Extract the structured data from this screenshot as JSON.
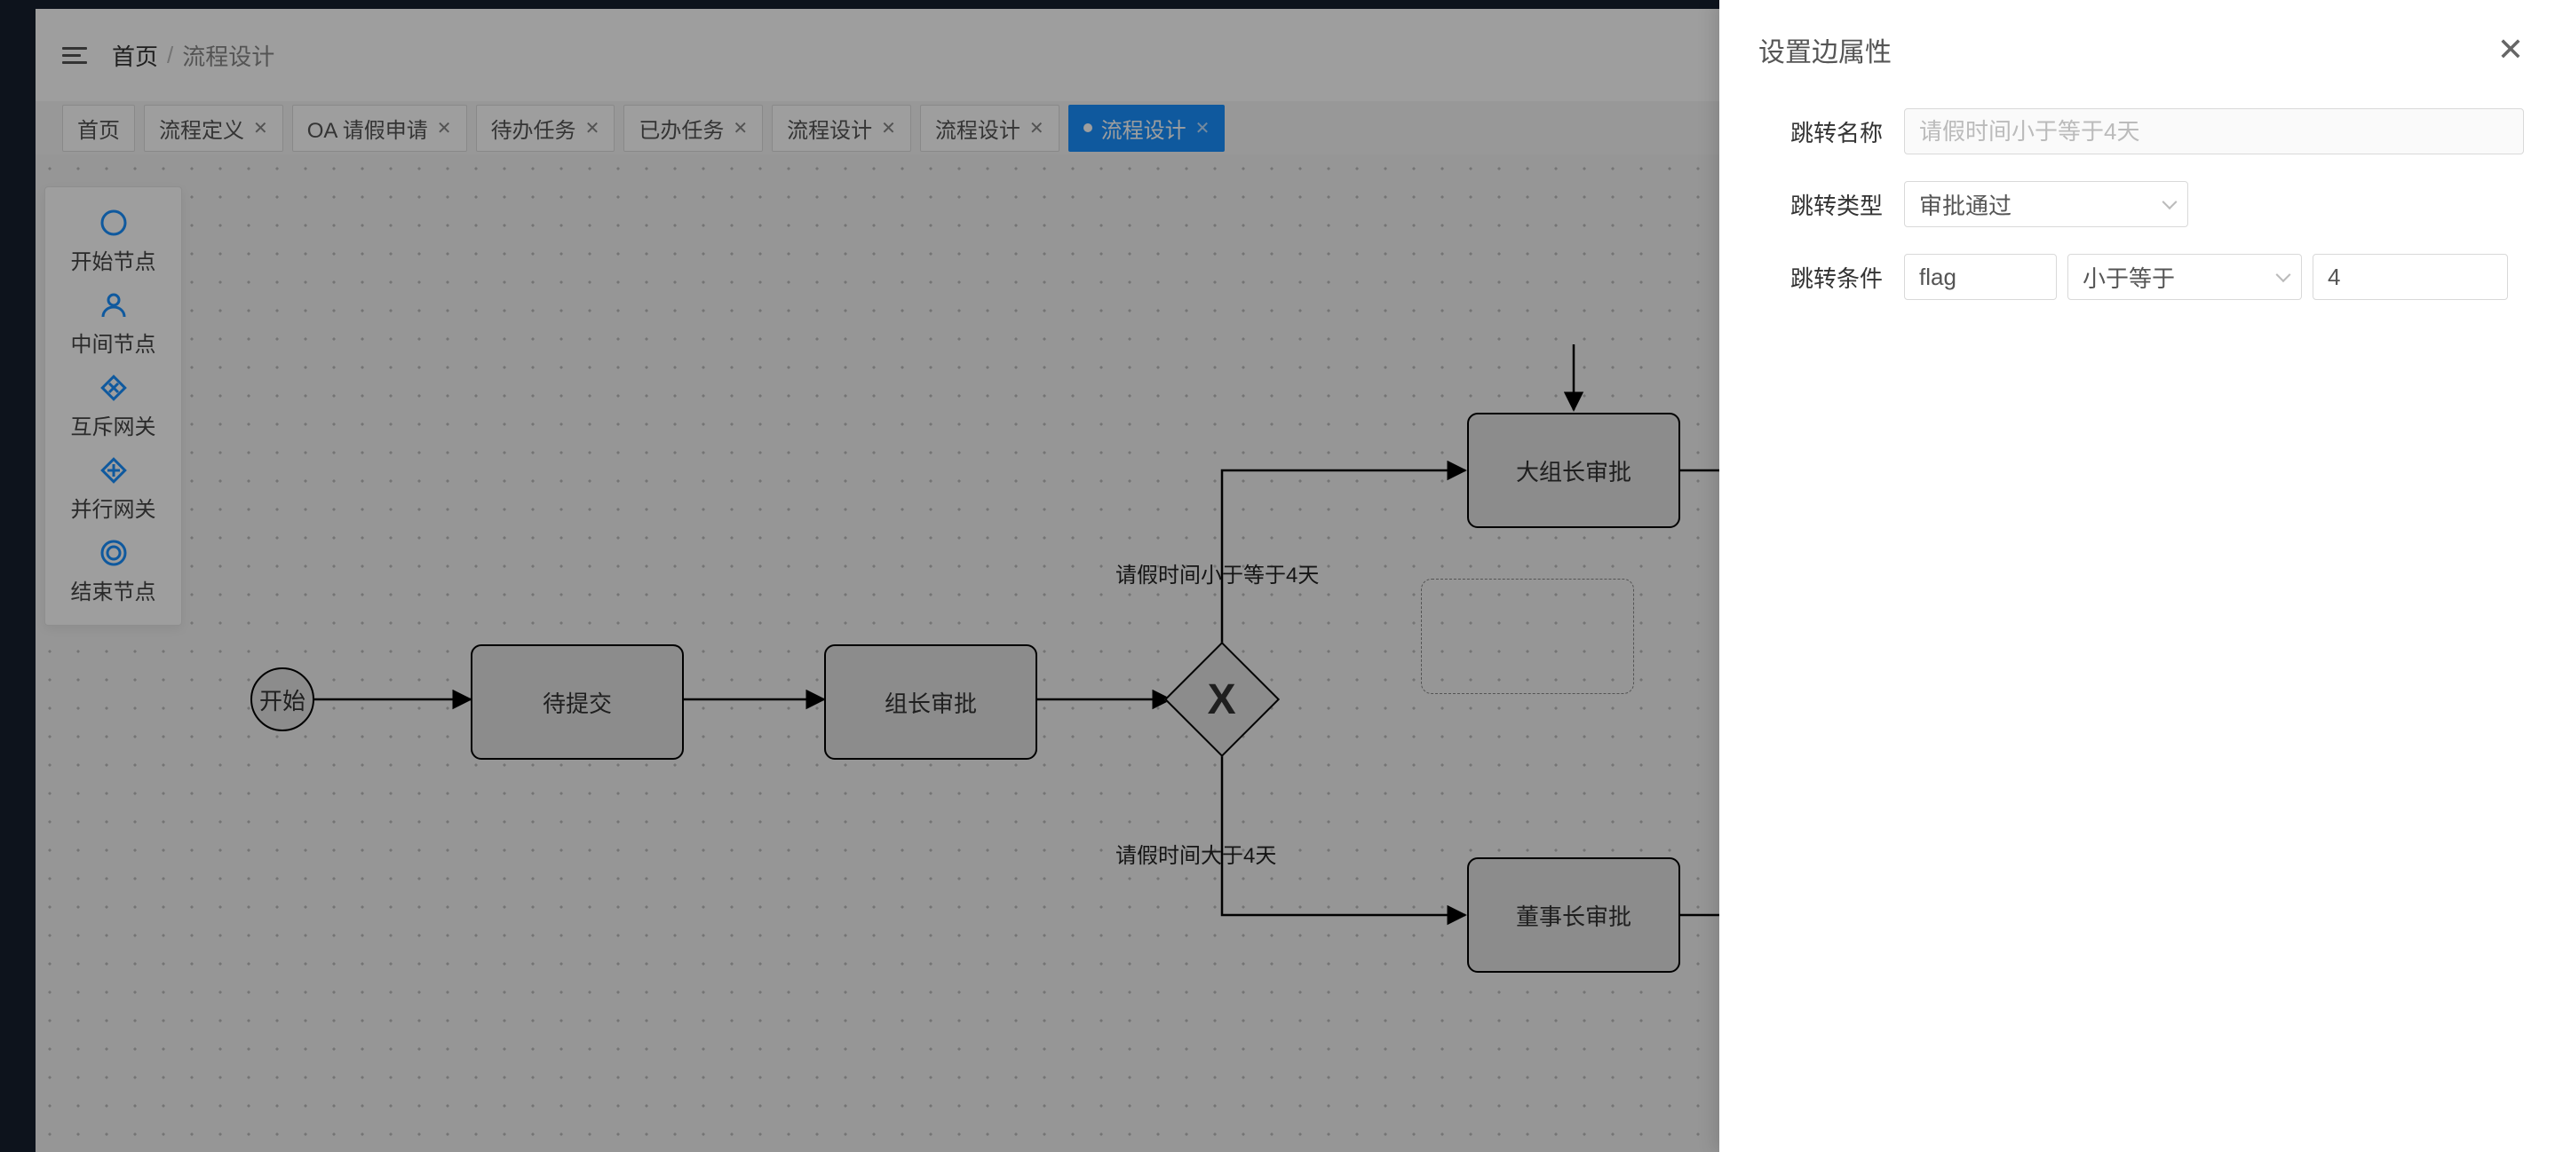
{
  "breadcrumb": {
    "home": "首页",
    "separator": "/",
    "current": "流程设计"
  },
  "tabs": [
    {
      "label": "首页",
      "closable": false,
      "active": false
    },
    {
      "label": "流程定义",
      "closable": true,
      "active": false
    },
    {
      "label": "OA 请假申请",
      "closable": true,
      "active": false
    },
    {
      "label": "待办任务",
      "closable": true,
      "active": false
    },
    {
      "label": "已办任务",
      "closable": true,
      "active": false
    },
    {
      "label": "流程设计",
      "closable": true,
      "active": false
    },
    {
      "label": "流程设计",
      "closable": true,
      "active": false
    },
    {
      "label": "流程设计",
      "closable": true,
      "active": true,
      "dirty": true
    }
  ],
  "palette": [
    {
      "icon": "circle-icon",
      "label": "开始节点"
    },
    {
      "icon": "user-icon",
      "label": "中间节点"
    },
    {
      "icon": "gateway-xor-icon",
      "label": "互斥网关"
    },
    {
      "icon": "gateway-and-icon",
      "label": "并行网关"
    },
    {
      "icon": "end-circle-icon",
      "label": "结束节点"
    }
  ],
  "flow": {
    "start": "开始",
    "nodes": {
      "submit": "待提交",
      "leader": "组长审批",
      "big": "大组长审批",
      "boss": "董事长审批"
    },
    "edge_labels": {
      "le4": "请假时间小于等于4天",
      "gt4": "请假时间大于4天"
    }
  },
  "drawer": {
    "title": "设置边属性",
    "form": {
      "name_label": "跳转名称",
      "name_placeholder": "请假时间小于等于4天",
      "name_value": "",
      "type_label": "跳转类型",
      "type_value": "审批通过",
      "cond_label": "跳转条件",
      "cond_var": "flag",
      "cond_op": "小于等于",
      "cond_val": "4"
    }
  }
}
